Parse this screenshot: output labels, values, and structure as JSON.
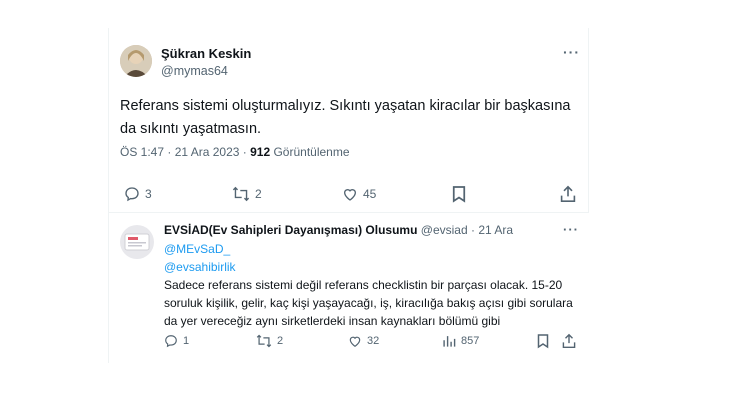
{
  "main_tweet": {
    "author_name": "Şükran Keskin",
    "author_handle": "@mymas64",
    "text": "Referans sistemi oluşturmalıyız. Sıkıntı yaşatan kiracılar bir başkasına da sıkıntı yaşatmasın.",
    "time": "ÖS 1:47 · 21 Ara 2023 ·",
    "views_count": "912",
    "views_label": "Görüntülenme",
    "replies": "3",
    "retweets": "2",
    "likes": "45"
  },
  "reply": {
    "author_name": "EVSİAD(Ev Sahipleri Dayanışması) Olusumu",
    "author_handle": "@evsiad",
    "date": "· 21 Ara",
    "mention_1": "@MEvSaD_",
    "mention_2": "@evsahibirlik",
    "text": "Sadece referans sistemi değil referans checklistin bir parçası olacak. 15-20 soruluk kişilik, gelir, kaç kişi yaşayacağı, iş, kiracılığa bakış açısı gibi sorulara da yer vereceğiz aynı sirketlerdeki insan kaynakları bölümü gibi",
    "replies": "1",
    "retweets": "2",
    "likes": "32",
    "views": "857"
  },
  "colors": {
    "text": "#0f1419",
    "secondary": "#536471",
    "link": "#1d9bf0",
    "border": "#eff3f4"
  }
}
